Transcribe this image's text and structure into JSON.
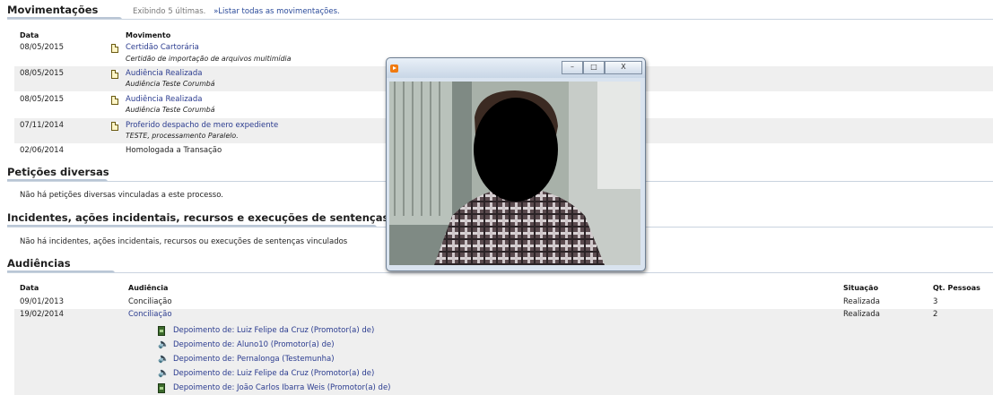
{
  "movimentacoes": {
    "title": "Movimentações",
    "summary": "Exibindo 5 últimas.",
    "list_all_link": "»Listar todas as movimentações.",
    "col_date": "Data",
    "col_movimento": "Movimento",
    "rows": [
      {
        "date": "08/05/2015",
        "title": "Certidão Cartorária",
        "detail": "Certidão de importação de arquivos multimídia",
        "link": true
      },
      {
        "date": "08/05/2015",
        "title": "Audiência Realizada",
        "detail": "Audiência Teste Corumbá",
        "link": true
      },
      {
        "date": "08/05/2015",
        "title": "Audiência Realizada",
        "detail": "Audiência Teste Corumbá",
        "link": true
      },
      {
        "date": "07/11/2014",
        "title": "Proferido despacho de mero expediente",
        "detail": "TESTE, processamento Paralelo.",
        "link": true
      },
      {
        "date": "02/06/2014",
        "title": "Homologada a Transação",
        "detail": "",
        "link": false
      }
    ]
  },
  "peticoes": {
    "title": "Petições diversas",
    "note": "Não há petições diversas vinculadas a este processo."
  },
  "incidentes": {
    "title": "Incidentes, ações incidentais, recursos e execuções de sentenças",
    "note": "Não há incidentes, ações incidentais, recursos ou execuções de sentenças vinculados"
  },
  "audiencias": {
    "title": "Audiências",
    "col_date": "Data",
    "col_audiencia": "Audiência",
    "col_situacao": "Situação",
    "col_qt": "Qt. Pessoas",
    "rows": [
      {
        "date": "09/01/2013",
        "audiencia": "Conciliação",
        "situacao": "Realizada",
        "qt": "3"
      },
      {
        "date": "19/02/2014",
        "audiencia": "Conciliação",
        "situacao": "Realizada",
        "qt": "2"
      }
    ],
    "depoimentos": [
      {
        "icon": "film-icon",
        "text": "Depoimento de: Luiz Felipe da Cruz (Promotor(a) de)"
      },
      {
        "icon": "speaker-icon",
        "text": "Depoimento de: Aluno10 (Promotor(a) de)"
      },
      {
        "icon": "speaker-icon",
        "text": "Depoimento de: Pernalonga (Testemunha)"
      },
      {
        "icon": "speaker-icon",
        "text": "Depoimento de: Luiz Felipe da Cruz (Promotor(a) de)"
      },
      {
        "icon": "film-icon",
        "text": "Depoimento de: João Carlos Ibarra Weis (Promotor(a) de)"
      }
    ]
  },
  "video_window": {
    "minimize": "–",
    "maximize": "□",
    "close": "X"
  }
}
